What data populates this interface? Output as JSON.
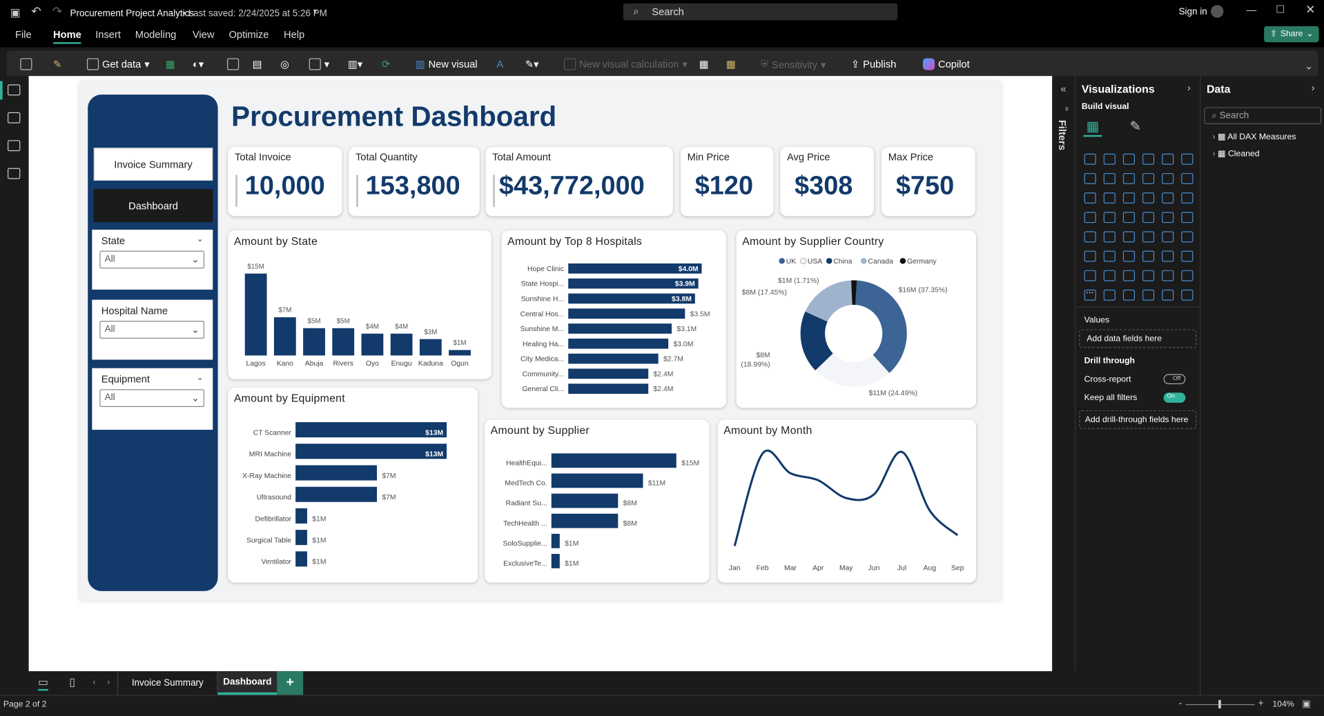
{
  "app": {
    "title": "Procurement Project Analytics",
    "saved": "• Last saved: 2/24/2025 at 5:26 PM",
    "search": "Search",
    "signin": "Sign in",
    "share": "Share"
  },
  "menu": [
    "File",
    "Home",
    "Insert",
    "Modeling",
    "View",
    "Optimize",
    "Help"
  ],
  "ribbon": {
    "get_data": "Get data",
    "new_visual": "New visual",
    "new_calc": "New visual calculation",
    "sensitivity": "Sensitivity",
    "publish": "Publish",
    "copilot": "Copilot"
  },
  "dashboard": {
    "title": "Procurement Dashboard",
    "nav": {
      "invoice": "Invoice Summary",
      "dashboard": "Dashboard"
    },
    "slicers": [
      {
        "label": "State",
        "value": "All"
      },
      {
        "label": "Hospital Name",
        "value": "All"
      },
      {
        "label": "Equipment",
        "value": "All"
      }
    ],
    "kpis": [
      {
        "title": "Total Invoice",
        "value": "10,000"
      },
      {
        "title": "Total Quantity",
        "value": "153,800"
      },
      {
        "title": "Total Amount",
        "value": "$43,772,000"
      },
      {
        "title": "Min Price",
        "value": "$120"
      },
      {
        "title": "Avg Price",
        "value": "$308"
      },
      {
        "title": "Max Price",
        "value": "$750"
      }
    ]
  },
  "chart_data": [
    {
      "type": "bar",
      "title": "Amount by State",
      "categories": [
        "Lagos",
        "Kano",
        "Abuja",
        "Rivers",
        "Oyo",
        "Enugu",
        "Kaduna",
        "Ogun"
      ],
      "values": [
        15,
        7,
        5,
        5,
        4,
        4,
        3,
        1
      ],
      "labels": [
        "$15M",
        "$7M",
        "$5M",
        "$5M",
        "$4M",
        "$4M",
        "$3M",
        "$1M"
      ],
      "color": "#123a6b"
    },
    {
      "type": "bar",
      "title": "Amount by Top 8 Hospitals",
      "categories": [
        "Hope Clinic",
        "State Hospi...",
        "Sunshine H...",
        "Central Hos...",
        "Sunshine M...",
        "Healing Ha...",
        "City Medica...",
        "Community...",
        "General Cli..."
      ],
      "values": [
        4.0,
        3.9,
        3.8,
        3.5,
        3.1,
        3.0,
        2.7,
        2.4,
        2.4
      ],
      "labels": [
        "$4.0M",
        "$3.9M",
        "$3.8M",
        "$3.5M",
        "$3.1M",
        "$3.0M",
        "$2.7M",
        "$2.4M",
        "$2.4M"
      ]
    },
    {
      "type": "pie",
      "title": "Amount by Supplier Country",
      "legend": [
        "UK",
        "USA",
        "China",
        "Canada",
        "Germany"
      ],
      "colors": [
        "#3c6494",
        "#f3f5f8",
        "#123a6b",
        "#9fb3cc",
        "#111111"
      ],
      "values": [
        37.35,
        24.49,
        18.99,
        17.45,
        1.71
      ],
      "labels": [
        "$16M (37.35%)",
        "$11M (24.49%)",
        "$8M (18.99%)",
        "$8M (17.45%)",
        "$1M (1.71%)"
      ]
    },
    {
      "type": "bar",
      "title": "Amount by Equipment",
      "categories": [
        "CT Scanner",
        "MRI Machine",
        "X-Ray Machine",
        "Ultrasound",
        "Defibrillator",
        "Surgical Table",
        "Ventilator"
      ],
      "values": [
        13,
        13,
        7,
        7,
        1,
        1,
        1
      ],
      "labels": [
        "$13M",
        "$13M",
        "$7M",
        "$7M",
        "$1M",
        "$1M",
        "$1M"
      ]
    },
    {
      "type": "bar",
      "title": "Amount by Supplier",
      "categories": [
        "HealthEqui...",
        "MedTech Co.",
        "Radiant Su...",
        "TechHealth ...",
        "SoloSupplie...",
        "ExclusiveTe..."
      ],
      "values": [
        15,
        11,
        8,
        8,
        1,
        1
      ],
      "labels": [
        "$15M",
        "$11M",
        "$8M",
        "$8M",
        "$1M",
        "$1M"
      ]
    },
    {
      "type": "line",
      "title": "Amount by Month",
      "categories": [
        "Jan",
        "Feb",
        "Mar",
        "Apr",
        "May",
        "Jun",
        "Jul",
        "Aug",
        "Sep"
      ],
      "values": [
        1.0,
        6.2,
        5.1,
        4.7,
        3.7,
        3.9,
        6.3,
        3.0,
        1.6
      ]
    }
  ],
  "visualizations": {
    "title": "Visualizations",
    "build": "Build visual",
    "values": "Values",
    "add_data": "Add data fields here",
    "drill": "Drill through",
    "cross": "Cross-report",
    "cross_state": "Off",
    "keep": "Keep all filters",
    "keep_state": "On",
    "add_drill": "Add drill-through fields here"
  },
  "filters": "Filters",
  "data_pane": {
    "title": "Data",
    "search": "Search",
    "tables": [
      "All DAX Measures",
      "Cleaned"
    ]
  },
  "pages": {
    "tabs": [
      "Invoice Summary",
      "Dashboard"
    ],
    "active": "Dashboard",
    "status": "Page 2 of 2",
    "zoom": "104%"
  }
}
